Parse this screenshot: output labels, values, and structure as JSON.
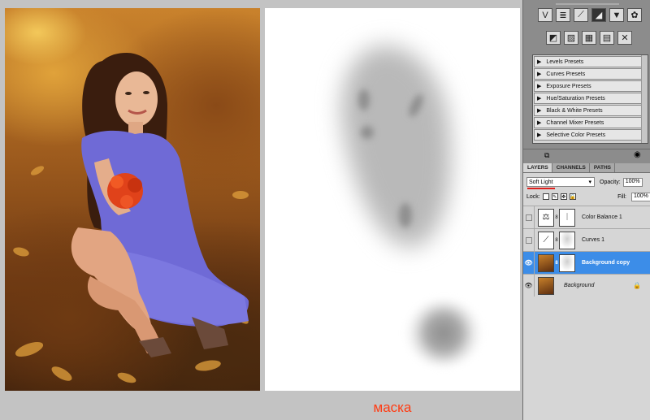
{
  "canvas": {
    "caption": "маска"
  },
  "panels": {
    "adjustment_icons_row1": [
      "V",
      "levels",
      "curves",
      "exposure",
      "hue-sat",
      "balance"
    ],
    "adjustment_icons_row2": [
      "bw",
      "photo-filter",
      "channel-mixer",
      "invert",
      "posterize",
      "threshold"
    ],
    "presets": [
      "Levels Presets",
      "Curves Presets",
      "Exposure Presets",
      "Hue/Saturation Presets",
      "Black & White Presets",
      "Channel Mixer Presets",
      "Selective Color Presets"
    ],
    "tabs": [
      "LAYERS",
      "CHANNELS",
      "PATHS"
    ],
    "blend_mode": "Soft Light",
    "opacity_label": "Opacity:",
    "opacity_value": "100%",
    "lock_label": "Lock:",
    "fill_label": "Fill:",
    "fill_value": "100%",
    "layers": [
      {
        "name": "Color Balance 1",
        "selected": false,
        "visible": false
      },
      {
        "name": "Curves 1",
        "selected": false,
        "visible": false
      },
      {
        "name": "Background copy",
        "selected": true,
        "visible": true
      },
      {
        "name": "Background",
        "selected": false,
        "visible": true
      }
    ]
  },
  "colors": {
    "selection": "#3c8de8",
    "caption": "#ff3b12",
    "blend_underline": "#e0201c"
  }
}
